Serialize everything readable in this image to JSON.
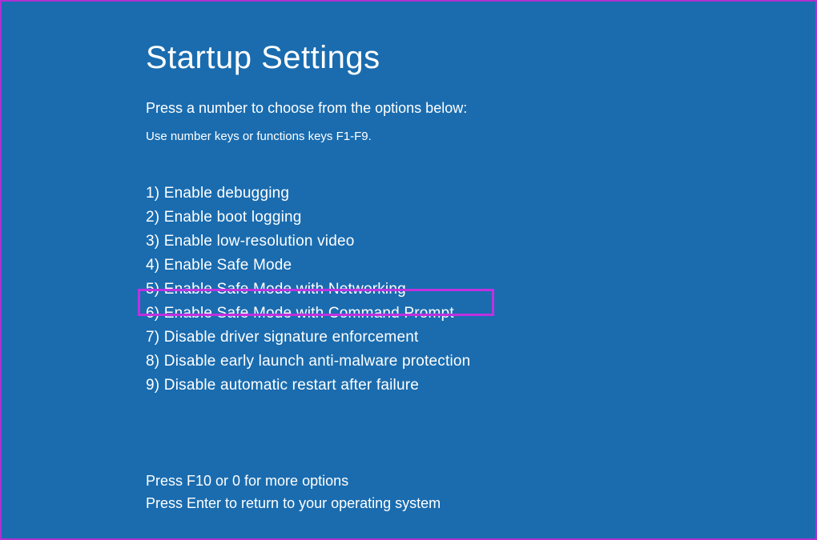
{
  "title": "Startup Settings",
  "subtitle": "Press a number to choose from the options below:",
  "hint": "Use number keys or functions keys F1-F9.",
  "options": [
    "1) Enable debugging",
    "2) Enable boot logging",
    "3) Enable low-resolution video",
    "4) Enable Safe Mode",
    "5) Enable Safe Mode with Networking",
    "6) Enable Safe Mode with Command Prompt",
    "7) Disable driver signature enforcement",
    "8) Disable early launch anti-malware protection",
    "9) Disable automatic restart after failure"
  ],
  "highlighted_index": 5,
  "footer": {
    "line1": "Press F10 or 0 for more options",
    "line2": "Press Enter to return to your operating system"
  }
}
